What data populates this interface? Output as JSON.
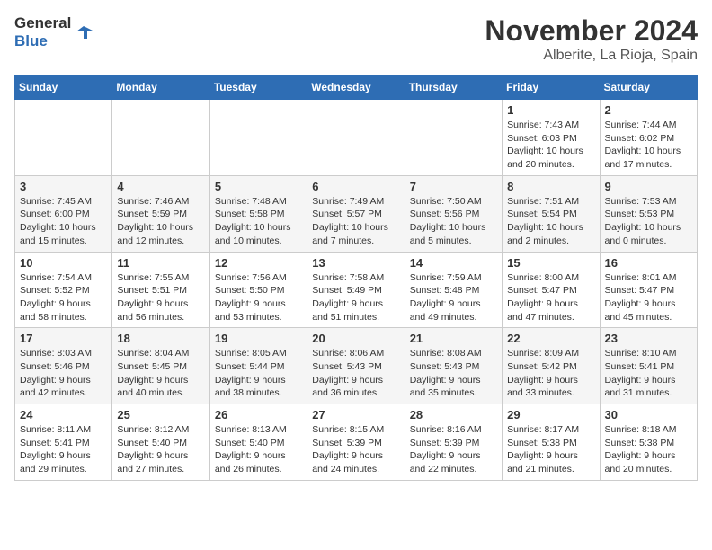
{
  "header": {
    "logo_general": "General",
    "logo_blue": "Blue",
    "month_title": "November 2024",
    "location": "Alberite, La Rioja, Spain"
  },
  "days_of_week": [
    "Sunday",
    "Monday",
    "Tuesday",
    "Wednesday",
    "Thursday",
    "Friday",
    "Saturday"
  ],
  "weeks": [
    [
      {
        "day": "",
        "info": ""
      },
      {
        "day": "",
        "info": ""
      },
      {
        "day": "",
        "info": ""
      },
      {
        "day": "",
        "info": ""
      },
      {
        "day": "",
        "info": ""
      },
      {
        "day": "1",
        "info": "Sunrise: 7:43 AM\nSunset: 6:03 PM\nDaylight: 10 hours and 20 minutes."
      },
      {
        "day": "2",
        "info": "Sunrise: 7:44 AM\nSunset: 6:02 PM\nDaylight: 10 hours and 17 minutes."
      }
    ],
    [
      {
        "day": "3",
        "info": "Sunrise: 7:45 AM\nSunset: 6:00 PM\nDaylight: 10 hours and 15 minutes."
      },
      {
        "day": "4",
        "info": "Sunrise: 7:46 AM\nSunset: 5:59 PM\nDaylight: 10 hours and 12 minutes."
      },
      {
        "day": "5",
        "info": "Sunrise: 7:48 AM\nSunset: 5:58 PM\nDaylight: 10 hours and 10 minutes."
      },
      {
        "day": "6",
        "info": "Sunrise: 7:49 AM\nSunset: 5:57 PM\nDaylight: 10 hours and 7 minutes."
      },
      {
        "day": "7",
        "info": "Sunrise: 7:50 AM\nSunset: 5:56 PM\nDaylight: 10 hours and 5 minutes."
      },
      {
        "day": "8",
        "info": "Sunrise: 7:51 AM\nSunset: 5:54 PM\nDaylight: 10 hours and 2 minutes."
      },
      {
        "day": "9",
        "info": "Sunrise: 7:53 AM\nSunset: 5:53 PM\nDaylight: 10 hours and 0 minutes."
      }
    ],
    [
      {
        "day": "10",
        "info": "Sunrise: 7:54 AM\nSunset: 5:52 PM\nDaylight: 9 hours and 58 minutes."
      },
      {
        "day": "11",
        "info": "Sunrise: 7:55 AM\nSunset: 5:51 PM\nDaylight: 9 hours and 56 minutes."
      },
      {
        "day": "12",
        "info": "Sunrise: 7:56 AM\nSunset: 5:50 PM\nDaylight: 9 hours and 53 minutes."
      },
      {
        "day": "13",
        "info": "Sunrise: 7:58 AM\nSunset: 5:49 PM\nDaylight: 9 hours and 51 minutes."
      },
      {
        "day": "14",
        "info": "Sunrise: 7:59 AM\nSunset: 5:48 PM\nDaylight: 9 hours and 49 minutes."
      },
      {
        "day": "15",
        "info": "Sunrise: 8:00 AM\nSunset: 5:47 PM\nDaylight: 9 hours and 47 minutes."
      },
      {
        "day": "16",
        "info": "Sunrise: 8:01 AM\nSunset: 5:47 PM\nDaylight: 9 hours and 45 minutes."
      }
    ],
    [
      {
        "day": "17",
        "info": "Sunrise: 8:03 AM\nSunset: 5:46 PM\nDaylight: 9 hours and 42 minutes."
      },
      {
        "day": "18",
        "info": "Sunrise: 8:04 AM\nSunset: 5:45 PM\nDaylight: 9 hours and 40 minutes."
      },
      {
        "day": "19",
        "info": "Sunrise: 8:05 AM\nSunset: 5:44 PM\nDaylight: 9 hours and 38 minutes."
      },
      {
        "day": "20",
        "info": "Sunrise: 8:06 AM\nSunset: 5:43 PM\nDaylight: 9 hours and 36 minutes."
      },
      {
        "day": "21",
        "info": "Sunrise: 8:08 AM\nSunset: 5:43 PM\nDaylight: 9 hours and 35 minutes."
      },
      {
        "day": "22",
        "info": "Sunrise: 8:09 AM\nSunset: 5:42 PM\nDaylight: 9 hours and 33 minutes."
      },
      {
        "day": "23",
        "info": "Sunrise: 8:10 AM\nSunset: 5:41 PM\nDaylight: 9 hours and 31 minutes."
      }
    ],
    [
      {
        "day": "24",
        "info": "Sunrise: 8:11 AM\nSunset: 5:41 PM\nDaylight: 9 hours and 29 minutes."
      },
      {
        "day": "25",
        "info": "Sunrise: 8:12 AM\nSunset: 5:40 PM\nDaylight: 9 hours and 27 minutes."
      },
      {
        "day": "26",
        "info": "Sunrise: 8:13 AM\nSunset: 5:40 PM\nDaylight: 9 hours and 26 minutes."
      },
      {
        "day": "27",
        "info": "Sunrise: 8:15 AM\nSunset: 5:39 PM\nDaylight: 9 hours and 24 minutes."
      },
      {
        "day": "28",
        "info": "Sunrise: 8:16 AM\nSunset: 5:39 PM\nDaylight: 9 hours and 22 minutes."
      },
      {
        "day": "29",
        "info": "Sunrise: 8:17 AM\nSunset: 5:38 PM\nDaylight: 9 hours and 21 minutes."
      },
      {
        "day": "30",
        "info": "Sunrise: 8:18 AM\nSunset: 5:38 PM\nDaylight: 9 hours and 20 minutes."
      }
    ]
  ]
}
